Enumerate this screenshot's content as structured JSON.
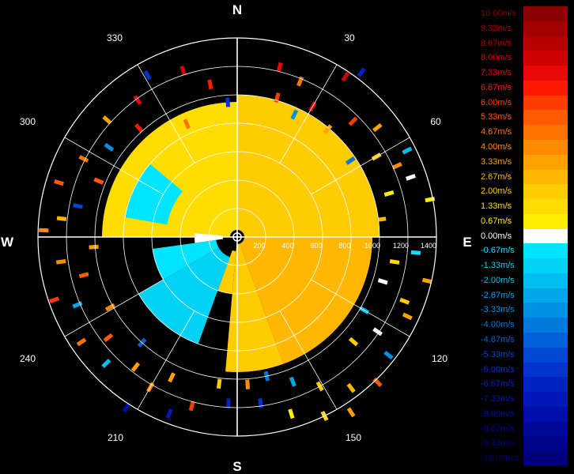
{
  "chart_data": {
    "type": "polar-scatter",
    "title": "",
    "compass": {
      "north": "N",
      "east": "E",
      "south": "S",
      "west": "W"
    },
    "angle_labels": [
      "30",
      "60",
      "120",
      "150",
      "210",
      "240",
      "300",
      "330"
    ],
    "range_labels": [
      "200",
      "400",
      "600",
      "800",
      "1000",
      "1200",
      "1400"
    ],
    "range_max": 1400,
    "legend": [
      {
        "label": "10.00m/s",
        "value": 10.0,
        "color": "#8b0000"
      },
      {
        "label": "9.33m/s",
        "value": 9.33,
        "color": "#a20000"
      },
      {
        "label": "8.67m/s",
        "value": 8.67,
        "color": "#b80000"
      },
      {
        "label": "8.00m/s",
        "value": 8.0,
        "color": "#d00000"
      },
      {
        "label": "7.33m/s",
        "value": 7.33,
        "color": "#e80808"
      },
      {
        "label": "6.67m/s",
        "value": 6.67,
        "color": "#ff1a00"
      },
      {
        "label": "6.00m/s",
        "value": 6.0,
        "color": "#ff3c00"
      },
      {
        "label": "5.33m/s",
        "value": 5.33,
        "color": "#ff5a00"
      },
      {
        "label": "4.67m/s",
        "value": 4.67,
        "color": "#ff7400"
      },
      {
        "label": "4.00m/s",
        "value": 4.0,
        "color": "#ff8c00"
      },
      {
        "label": "3.33m/s",
        "value": 3.33,
        "color": "#ffa200"
      },
      {
        "label": "2.67m/s",
        "value": 2.67,
        "color": "#ffb700"
      },
      {
        "label": "2.00m/s",
        "value": 2.0,
        "color": "#ffcc00"
      },
      {
        "label": "1.33m/s",
        "value": 1.33,
        "color": "#ffdd00"
      },
      {
        "label": "0.67m/s",
        "value": 0.67,
        "color": "#ffee00"
      },
      {
        "label": "0.00m/s",
        "value": 0.0,
        "color": "#ffffff"
      },
      {
        "label": "-0.67m/s",
        "value": -0.67,
        "color": "#00e5ff"
      },
      {
        "label": "-1.33m/s",
        "value": -1.33,
        "color": "#00d2f5"
      },
      {
        "label": "-2.00m/s",
        "value": -2.0,
        "color": "#00bff0"
      },
      {
        "label": "-2.67m/s",
        "value": -2.67,
        "color": "#00a8ea"
      },
      {
        "label": "-3.33m/s",
        "value": -3.33,
        "color": "#0090e4"
      },
      {
        "label": "-4.00m/s",
        "value": -4.0,
        "color": "#0078dc"
      },
      {
        "label": "-4.67m/s",
        "value": -4.67,
        "color": "#0060d8"
      },
      {
        "label": "-5.33m/s",
        "value": -5.33,
        "color": "#0048d2"
      },
      {
        "label": "-6.00m/s",
        "value": -6.0,
        "color": "#0034cc"
      },
      {
        "label": "-6.67m/s",
        "value": -6.67,
        "color": "#0024c4"
      },
      {
        "label": "-7.33m/s",
        "value": -7.33,
        "color": "#0018b8"
      },
      {
        "label": "-8.00m/s",
        "value": -8.0,
        "color": "#000eaa"
      },
      {
        "label": "-8.67m/s",
        "value": -8.67,
        "color": "#00089a"
      },
      {
        "label": "-9.33m/s",
        "value": -9.33,
        "color": "#00048a"
      },
      {
        "label": "-10.00m/s",
        "value": -10.0,
        "color": "#000078"
      }
    ],
    "sectors": [
      {
        "az_from": 270,
        "az_to": 360,
        "range_from": 50,
        "range_to": 950,
        "velocity": 1.5
      },
      {
        "az_from": 0,
        "az_to": 90,
        "range_from": 50,
        "range_to": 1000,
        "velocity": 2.2
      },
      {
        "az_from": 90,
        "az_to": 160,
        "range_from": 50,
        "range_to": 950,
        "velocity": 2.4
      },
      {
        "az_from": 160,
        "az_to": 185,
        "range_from": 50,
        "range_to": 950,
        "velocity": 2.0
      },
      {
        "az_from": 185,
        "az_to": 200,
        "range_from": 100,
        "range_to": 400,
        "velocity": 1.8
      },
      {
        "az_from": 200,
        "az_to": 240,
        "range_from": 150,
        "range_to": 800,
        "velocity": -1.4
      },
      {
        "az_from": 240,
        "az_to": 262,
        "range_from": 150,
        "range_to": 600,
        "velocity": -1.0
      },
      {
        "az_from": 280,
        "az_to": 310,
        "range_from": 500,
        "range_to": 800,
        "velocity": -1.0
      },
      {
        "az_from": 262,
        "az_to": 275,
        "range_from": 100,
        "range_to": 300,
        "velocity": 0.0
      }
    ],
    "points": [
      {
        "az": 14,
        "range": 1230,
        "velocity": 7.3
      },
      {
        "az": 16,
        "range": 1020,
        "velocity": 6.0
      },
      {
        "az": 22,
        "range": 1180,
        "velocity": 4.5
      },
      {
        "az": 25,
        "range": 950,
        "velocity": -3.3
      },
      {
        "az": 30,
        "range": 1060,
        "velocity": 7.0
      },
      {
        "az": 34,
        "range": 1360,
        "velocity": 8.0
      },
      {
        "az": 37,
        "range": 1450,
        "velocity": -7.0
      },
      {
        "az": 40,
        "range": 990,
        "velocity": 3.3
      },
      {
        "az": 45,
        "range": 1150,
        "velocity": 6.0
      },
      {
        "az": 52,
        "range": 1250,
        "velocity": 3.0
      },
      {
        "az": 56,
        "range": 960,
        "velocity": -4.0
      },
      {
        "az": 60,
        "range": 1130,
        "velocity": 2.0
      },
      {
        "az": 63,
        "range": 1340,
        "velocity": -2.0
      },
      {
        "az": 66,
        "range": 1230,
        "velocity": 4.0
      },
      {
        "az": 71,
        "range": 1290,
        "velocity": 0.0
      },
      {
        "az": 74,
        "range": 1110,
        "velocity": 1.0
      },
      {
        "az": 79,
        "range": 1380,
        "velocity": 0.7
      },
      {
        "az": 83,
        "range": 1020,
        "velocity": 2.7
      },
      {
        "az": 95,
        "range": 1260,
        "velocity": -0.7
      },
      {
        "az": 99,
        "range": 1120,
        "velocity": 1.5
      },
      {
        "az": 103,
        "range": 1370,
        "velocity": 3.3
      },
      {
        "az": 107,
        "range": 1070,
        "velocity": 0.0
      },
      {
        "az": 111,
        "range": 1260,
        "velocity": 2.0
      },
      {
        "az": 115,
        "range": 1320,
        "velocity": 3.5
      },
      {
        "az": 120,
        "range": 1030,
        "velocity": -2.0
      },
      {
        "az": 124,
        "range": 1190,
        "velocity": 0.0
      },
      {
        "az": 128,
        "range": 1350,
        "velocity": -3.3
      },
      {
        "az": 132,
        "range": 1100,
        "velocity": 2.0
      },
      {
        "az": 136,
        "range": 1420,
        "velocity": 5.0
      },
      {
        "az": 143,
        "range": 1330,
        "velocity": 2.5
      },
      {
        "az": 147,
        "range": 1470,
        "velocity": 3.0
      },
      {
        "az": 151,
        "range": 1200,
        "velocity": 2.0
      },
      {
        "az": 154,
        "range": 1400,
        "velocity": 1.5
      },
      {
        "az": 159,
        "range": 1090,
        "velocity": -3.0
      },
      {
        "az": 163,
        "range": 1300,
        "velocity": 0.5
      },
      {
        "az": 168,
        "range": 1000,
        "velocity": -4.0
      },
      {
        "az": 172,
        "range": 1180,
        "velocity": -6.0
      },
      {
        "az": 176,
        "range": 1040,
        "velocity": 4.0
      },
      {
        "az": 183,
        "range": 1170,
        "velocity": -7.0
      },
      {
        "az": 187,
        "range": 1040,
        "velocity": 2.0
      },
      {
        "az": 195,
        "range": 1230,
        "velocity": 6.0
      },
      {
        "az": 201,
        "range": 1330,
        "velocity": -7.5
      },
      {
        "az": 205,
        "range": 1090,
        "velocity": 3.3
      },
      {
        "az": 210,
        "range": 1220,
        "velocity": 4.0
      },
      {
        "az": 213,
        "range": 1430,
        "velocity": -8.0
      },
      {
        "az": 218,
        "range": 1160,
        "velocity": 3.5
      },
      {
        "az": 222,
        "range": 1000,
        "velocity": -5.0
      },
      {
        "az": 226,
        "range": 1280,
        "velocity": -2.0
      },
      {
        "az": 232,
        "range": 1150,
        "velocity": 5.0
      },
      {
        "az": 236,
        "range": 1320,
        "velocity": 4.6
      },
      {
        "az": 241,
        "range": 1020,
        "velocity": 4.0
      },
      {
        "az": 247,
        "range": 1220,
        "velocity": -2.7
      },
      {
        "az": 251,
        "range": 1360,
        "velocity": 6.0
      },
      {
        "az": 256,
        "range": 1110,
        "velocity": 5.3
      },
      {
        "az": 262,
        "range": 1250,
        "velocity": 4.0
      },
      {
        "az": 266,
        "range": 1010,
        "velocity": 3.0
      },
      {
        "az": 272,
        "range": 1360,
        "velocity": 4.2
      },
      {
        "az": 276,
        "range": 1240,
        "velocity": 2.7
      },
      {
        "az": 281,
        "range": 1140,
        "velocity": -5.3
      },
      {
        "az": 287,
        "range": 1310,
        "velocity": 5.5
      },
      {
        "az": 292,
        "range": 1050,
        "velocity": 5.0
      },
      {
        "az": 297,
        "range": 1210,
        "velocity": 4.6
      },
      {
        "az": 305,
        "range": 1100,
        "velocity": -3.3
      },
      {
        "az": 312,
        "range": 1230,
        "velocity": 3.0
      },
      {
        "az": 318,
        "range": 1030,
        "velocity": 6.7
      },
      {
        "az": 324,
        "range": 1190,
        "velocity": 7.0
      },
      {
        "az": 331,
        "range": 1300,
        "velocity": -6.0
      },
      {
        "az": 336,
        "range": 870,
        "velocity": 4.5
      },
      {
        "az": 342,
        "range": 1230,
        "velocity": 8.0
      },
      {
        "az": 350,
        "range": 1090,
        "velocity": 6.7
      },
      {
        "az": 356,
        "range": 950,
        "velocity": -6.0
      }
    ]
  }
}
